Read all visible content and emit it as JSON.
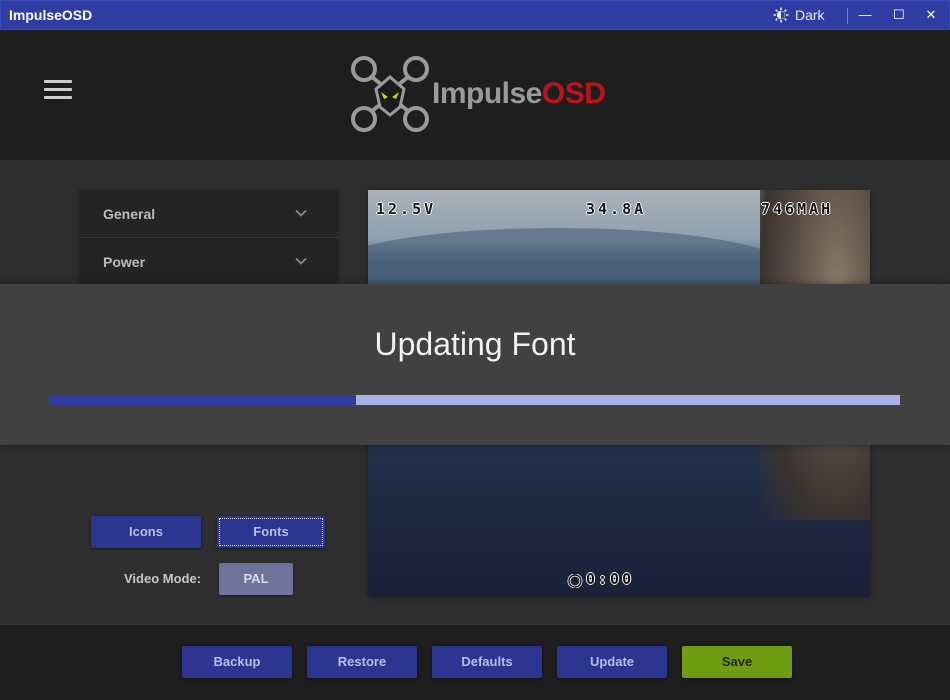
{
  "window": {
    "title": "ImpulseOSD",
    "theme_label": "Dark",
    "minimize": "—",
    "maximize": "☐",
    "close": "✕"
  },
  "logo": {
    "text_part1": "Impulse",
    "text_part2": "OSD"
  },
  "sidebar": {
    "items": [
      {
        "label": "General",
        "icon": "chevron-down-icon"
      },
      {
        "label": "Power",
        "icon": "chevron-down-icon"
      }
    ],
    "buttons": {
      "icons": "Icons",
      "fonts": "Fonts"
    },
    "video_mode": {
      "label": "Video Mode:",
      "value": "PAL"
    }
  },
  "osd": {
    "voltage": "12.5V",
    "current": "34.8A",
    "capacity": "746MAH",
    "timer_icon": "stopwatch-icon",
    "timer": "0:00"
  },
  "footer": {
    "backup": "Backup",
    "restore": "Restore",
    "defaults": "Defaults",
    "update": "Update",
    "save": "Save"
  },
  "dialog": {
    "title": "Updating Font",
    "progress_percent": 36
  },
  "colors": {
    "titlebar": "#2f3da3",
    "accent_button": "#2c3590",
    "save_button": "#6e9c12",
    "logo_red": "#c0121b"
  }
}
